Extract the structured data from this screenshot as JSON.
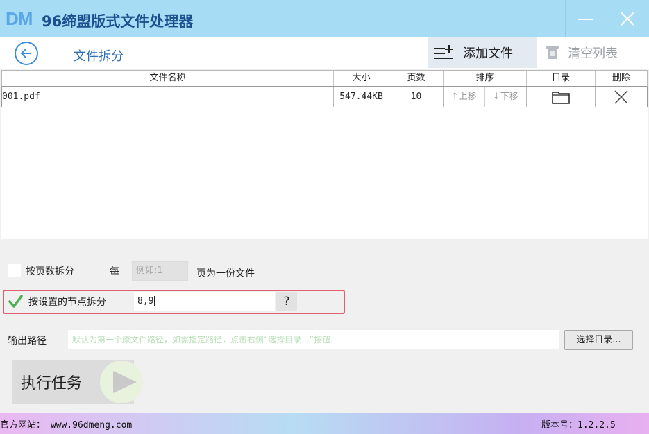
{
  "app": {
    "logo": "DM",
    "title": "96缔盟版式文件处理器"
  },
  "toolbar": {
    "page_title": "文件拆分",
    "add_file_label": "添加文件",
    "clear_list_label": "清空列表"
  },
  "table": {
    "headers": [
      "文件名称",
      "大小",
      "页数",
      "排序",
      "目录",
      "删除"
    ],
    "rows": [
      {
        "name": "001.pdf",
        "size": "547.44KB",
        "pages": "10",
        "move_up": "↑上移",
        "move_down": "↓下移"
      }
    ]
  },
  "options": {
    "split_by_pages_label": "按页数拆分",
    "split_by_pages_checked": false,
    "every_label": "每",
    "pages_placeholder": "例如:1",
    "per_file_label": "页为一份文件",
    "split_by_nodes_label": "按设置的节点拆分",
    "split_by_nodes_checked": true,
    "nodes_value": "8,9",
    "help_label": "?"
  },
  "output": {
    "label": "输出路径",
    "placeholder": "默认为第一个原文件路径，如需指定路径，点击右侧“选择目录...”按钮.",
    "choose_button": "选择目录..."
  },
  "run": {
    "label": "执行任务"
  },
  "status": {
    "website": "官方网站： www.96dmeng.com",
    "version": "版本号：1.2.2.5"
  },
  "colors": {
    "titlebar": "#a6dcf4",
    "accent": "#3b8fd8",
    "highlight_border": "#e06070",
    "check": "#4caf50"
  }
}
